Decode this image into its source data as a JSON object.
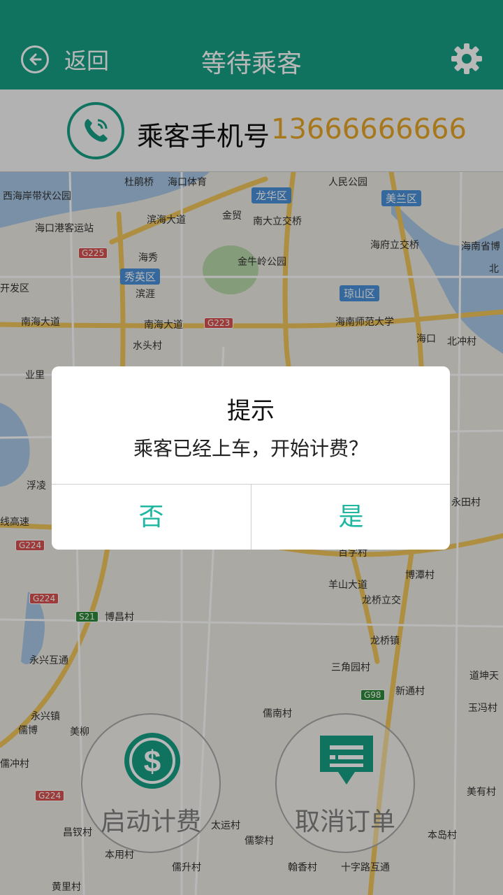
{
  "header": {
    "back_label": "返回",
    "title": "等待乘客"
  },
  "phone": {
    "label": "乘客手机号",
    "number": "13666666666"
  },
  "map": {
    "labels": [
      {
        "text": "西海岸带状公园"
      },
      {
        "text": "杜鹃桥"
      },
      {
        "text": "海口体育"
      },
      {
        "text": "人民公园"
      },
      {
        "text": "海口港客运站"
      },
      {
        "text": "滨海大道"
      },
      {
        "text": "金贸"
      },
      {
        "text": "南大立交桥"
      },
      {
        "text": "海府立交桥"
      },
      {
        "text": "海南省博"
      },
      {
        "text": "海秀"
      },
      {
        "text": "金牛岭公园"
      },
      {
        "text": "滨涯"
      },
      {
        "text": "开发区"
      },
      {
        "text": "南海大道"
      },
      {
        "text": "南海大道"
      },
      {
        "text": "海南师范大学"
      },
      {
        "text": "北冲村"
      },
      {
        "text": "水头村"
      },
      {
        "text": "业里"
      },
      {
        "text": "浮凌"
      },
      {
        "text": "线高速"
      },
      {
        "text": "永田村"
      },
      {
        "text": "博潭村"
      },
      {
        "text": "羊山大道"
      },
      {
        "text": "龙桥立交"
      },
      {
        "text": "博昌村"
      },
      {
        "text": "永兴互通"
      },
      {
        "text": "龙桥镇"
      },
      {
        "text": "三角园村"
      },
      {
        "text": "新通村"
      },
      {
        "text": "道坤天"
      },
      {
        "text": "玉冯村"
      },
      {
        "text": "永兴镇"
      },
      {
        "text": "儒南村"
      },
      {
        "text": "儒博"
      },
      {
        "text": "美柳"
      },
      {
        "text": "儒冲村"
      },
      {
        "text": "美有村"
      },
      {
        "text": "昌钗村"
      },
      {
        "text": "太运村"
      },
      {
        "text": "本岛村"
      },
      {
        "text": "儒黎村"
      },
      {
        "text": "本用村"
      },
      {
        "text": "儒升村"
      },
      {
        "text": "翰香村"
      },
      {
        "text": "十字路互通"
      },
      {
        "text": "黄里村"
      },
      {
        "text": "北"
      },
      {
        "text": "海口"
      },
      {
        "text": "百字村"
      }
    ],
    "districts": [
      {
        "text": "龙华区"
      },
      {
        "text": "美兰区"
      },
      {
        "text": "秀英区"
      },
      {
        "text": "琼山区"
      }
    ],
    "roads": [
      {
        "text": "G225"
      },
      {
        "text": "G223"
      },
      {
        "text": "G224"
      },
      {
        "text": "G224"
      },
      {
        "text": "S21"
      },
      {
        "text": "G98"
      },
      {
        "text": "G224"
      }
    ]
  },
  "actions": {
    "start_billing": "启动计费",
    "cancel_order": "取消订单"
  },
  "dialog": {
    "title": "提示",
    "message": "乘客已经上车，开始计费？",
    "no_label": "否",
    "yes_label": "是"
  },
  "colors": {
    "accent": "#16a085",
    "phone_number": "#e8a628",
    "dialog_button": "#1fb7a2"
  }
}
